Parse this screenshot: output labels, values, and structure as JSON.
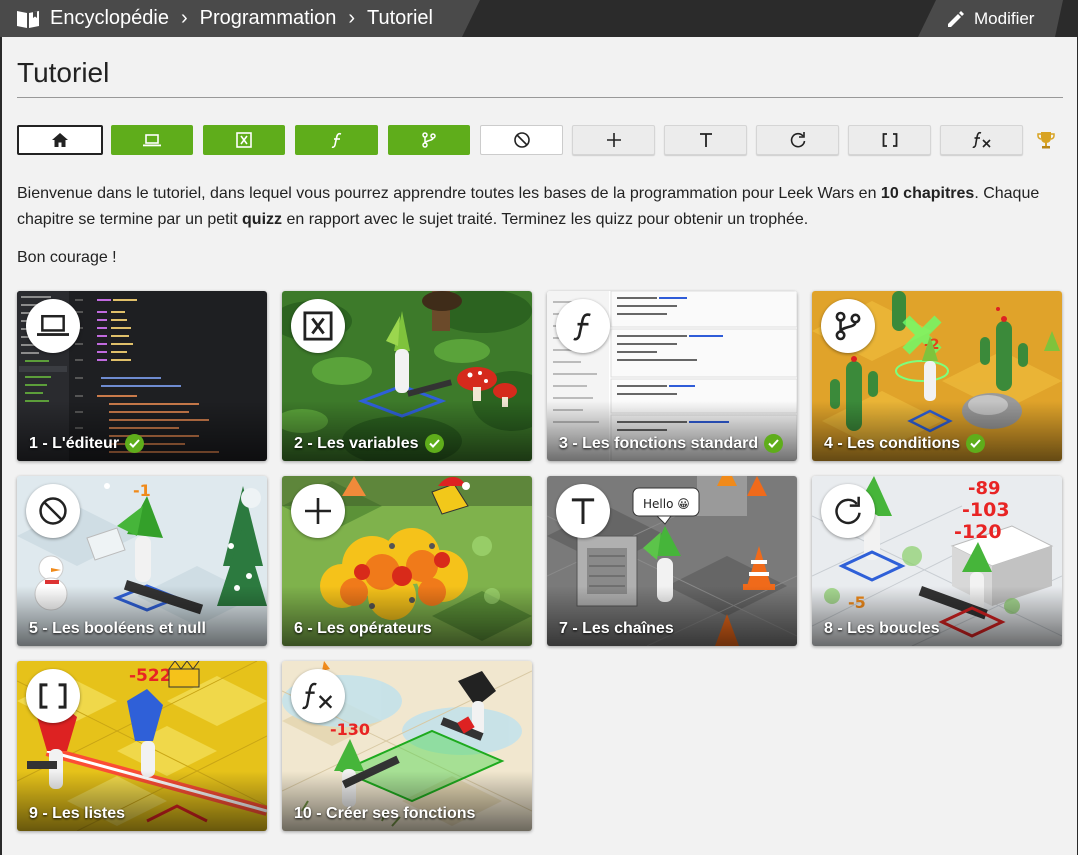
{
  "breadcrumb": {
    "items": [
      "Encyclopédie",
      "Programmation",
      "Tutoriel"
    ],
    "separator": "›"
  },
  "edit_button": {
    "label": "Modifier"
  },
  "page_title": "Tutoriel",
  "chapter_tabs": [
    {
      "icon": "home-icon",
      "state": "home"
    },
    {
      "icon": "laptop-icon",
      "state": "done"
    },
    {
      "icon": "variable-icon",
      "state": "done"
    },
    {
      "icon": "function-icon",
      "state": "done"
    },
    {
      "icon": "branch-icon",
      "state": "done"
    },
    {
      "icon": "null-icon",
      "state": "current"
    },
    {
      "icon": "plus-icon",
      "state": "todo"
    },
    {
      "icon": "text-icon",
      "state": "todo"
    },
    {
      "icon": "loop-icon",
      "state": "todo"
    },
    {
      "icon": "brackets-icon",
      "state": "todo"
    },
    {
      "icon": "fx-icon",
      "state": "todo"
    }
  ],
  "intro": {
    "part1": "Bienvenue dans le tutoriel, dans lequel vous pourrez apprendre toutes les bases de la programmation pour Leek Wars en ",
    "bold1": "10 chapitres",
    "part2": ". Chaque chapitre se termine par un petit ",
    "bold2": "quizz",
    "part3": " en rapport avec le sujet traité. Terminez les quizz pour obtenir un trophée."
  },
  "courage": "Bon courage !",
  "chapters": [
    {
      "label": "1 - L'éditeur",
      "done": true,
      "icon": "laptop-icon"
    },
    {
      "label": "2 - Les variables",
      "done": true,
      "icon": "variable-icon"
    },
    {
      "label": "3 - Les fonctions standard",
      "done": true,
      "icon": "function-icon"
    },
    {
      "label": "4 - Les conditions",
      "done": true,
      "icon": "branch-icon"
    },
    {
      "label": "5 - Les booléens et null",
      "done": false,
      "icon": "null-icon"
    },
    {
      "label": "6 - Les opérateurs",
      "done": false,
      "icon": "plus-icon"
    },
    {
      "label": "7 - Les chaînes",
      "done": false,
      "icon": "text-icon"
    },
    {
      "label": "8 - Les boucles",
      "done": false,
      "icon": "loop-icon"
    },
    {
      "label": "9 - Les listes",
      "done": false,
      "icon": "brackets-icon"
    },
    {
      "label": "10 - Créer ses fonctions",
      "done": false,
      "icon": "fx-icon"
    }
  ],
  "scene_text": {
    "dmg5": "-1",
    "hello": "Hello 😀",
    "dmg8a": "-89",
    "dmg8b": "-103",
    "dmg8c": "-120",
    "dmg8d": "-5",
    "dmg9": "-522",
    "dmg10": "-130",
    "dmg4": "-2"
  },
  "colors": {
    "done_green": "#5fad1b",
    "header": "#4a4a4a",
    "panel": "#f2f2f2"
  }
}
